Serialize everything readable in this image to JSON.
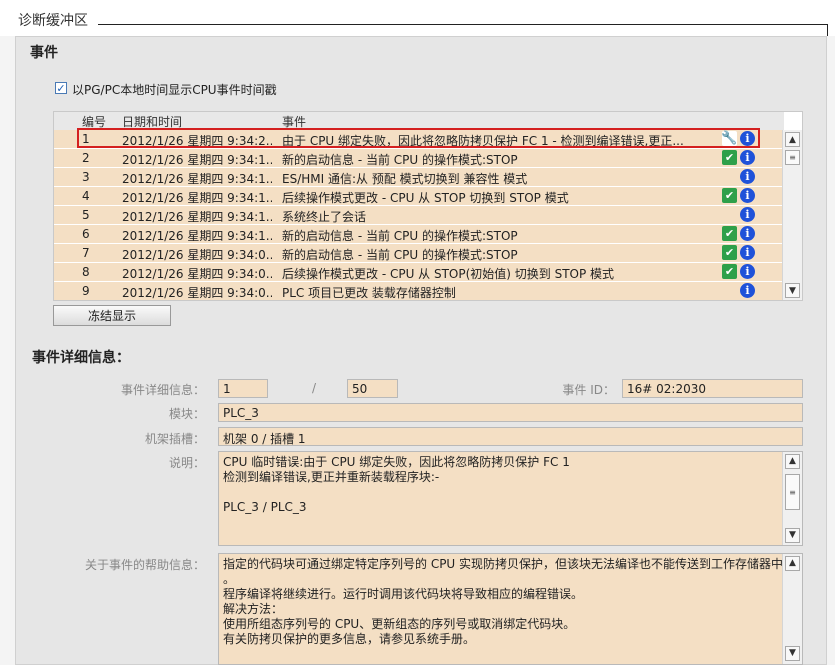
{
  "window": {
    "title": "诊断缓冲区"
  },
  "events_section": {
    "title": "事件",
    "checkbox_label": "以PG/PC本地时间显示CPU事件时间戳",
    "checkbox_checked": true,
    "columns": [
      "编号",
      "日期和时间",
      "事件"
    ],
    "rows": [
      {
        "num": "1",
        "date": "2012/1/26 星期四 9:34:2...",
        "event": "由于 CPU 绑定失败，因此将忽略防拷贝保护 FC 1 - 检测到编译错误,更正...",
        "icon1": "tool-icon",
        "icon2": "info-icon",
        "selected": true
      },
      {
        "num": "2",
        "date": "2012/1/26 星期四 9:34:1...",
        "event": "新的启动信息 - 当前 CPU 的操作模式:STOP",
        "icon1": "check-icon",
        "icon2": "info-icon"
      },
      {
        "num": "3",
        "date": "2012/1/26 星期四 9:34:1...",
        "event": "ES/HMI 通信:从 预配 模式切换到 兼容性 模式",
        "icon1": "",
        "icon2": "info-icon"
      },
      {
        "num": "4",
        "date": "2012/1/26 星期四 9:34:1...",
        "event": "后续操作模式更改 - CPU 从 STOP 切换到 STOP 模式",
        "icon1": "check-icon",
        "icon2": "info-icon"
      },
      {
        "num": "5",
        "date": "2012/1/26 星期四 9:34:1...",
        "event": "系统终止了会话",
        "icon1": "",
        "icon2": "info-icon"
      },
      {
        "num": "6",
        "date": "2012/1/26 星期四 9:34:1...",
        "event": "新的启动信息 - 当前 CPU 的操作模式:STOP",
        "icon1": "check-icon",
        "icon2": "info-icon"
      },
      {
        "num": "7",
        "date": "2012/1/26 星期四 9:34:0...",
        "event": "新的启动信息 - 当前 CPU 的操作模式:STOP",
        "icon1": "check-icon",
        "icon2": "info-icon"
      },
      {
        "num": "8",
        "date": "2012/1/26 星期四 9:34:0...",
        "event": "后续操作模式更改 - CPU 从 STOP(初始值) 切换到 STOP 模式",
        "icon1": "check-icon",
        "icon2": "info-icon"
      },
      {
        "num": "9",
        "date": "2012/1/26 星期四 9:34:0...",
        "event": "PLC 项目已更改 装载存储器控制",
        "icon1": "",
        "icon2": "info-icon"
      }
    ],
    "freeze_button": "冻结显示"
  },
  "details": {
    "title": "事件详细信息：",
    "detail_label": "事件详细信息：",
    "detail_index": "1",
    "detail_sep": "/",
    "detail_total": "50",
    "event_id_label": "事件 ID：",
    "event_id": "16# 02:2030",
    "module_label": "模块：",
    "module": "PLC_3",
    "rack_label": "机架插槽：",
    "rack": "机架 0 / 插槽 1",
    "desc_label": "说明：",
    "desc_lines": [
      "CPU 临时错误:由于 CPU 绑定失败，因此将忽略防拷贝保护 FC 1",
      " 检测到编译错误,更正并重新装载程序块:-",
      "",
      " PLC_3 / PLC_3"
    ],
    "help_label": "关于事件的帮助信息：",
    "help_lines": [
      "指定的代码块可通过绑定特定序列号的 CPU 实现防拷贝保护，但该块无法编译也不能传送到工作存储器中",
      "。",
      "程序编译将继续进行。运行时调用该代码块将导致相应的编程错误。",
      "解决方法：",
      "使用所组态序列号的 CPU、更新组态的序列号或取消绑定代码块。",
      "有关防拷贝保护的更多信息，请参见系统手册。"
    ]
  },
  "colors": {
    "row_bg": "#f4dfc4",
    "selection": "#d42020",
    "info": "#1f52d9",
    "ok": "#2ea04a"
  }
}
